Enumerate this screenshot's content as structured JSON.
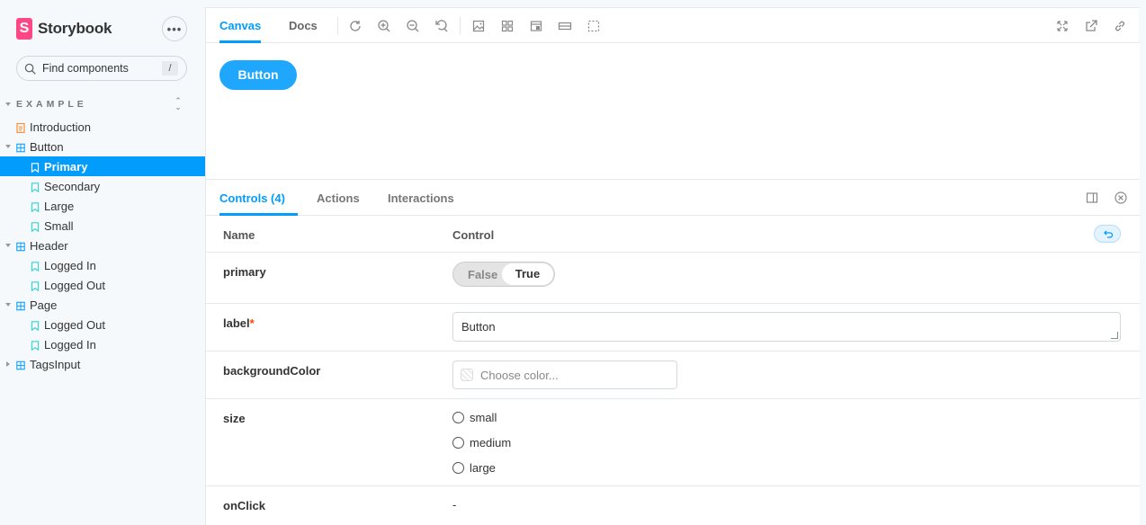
{
  "brand": {
    "logo_letter": "S",
    "name": "Storybook",
    "menu_icon": "ellipsis-icon"
  },
  "search": {
    "placeholder": "Find components",
    "shortcut": "/"
  },
  "sidebar": {
    "section_title": "EXAMPLE",
    "items": [
      {
        "label": "Introduction",
        "type": "docs",
        "level": 0
      },
      {
        "label": "Button",
        "type": "component",
        "level": 0,
        "expanded": true
      },
      {
        "label": "Primary",
        "type": "story",
        "level": 1,
        "selected": true
      },
      {
        "label": "Secondary",
        "type": "story",
        "level": 1
      },
      {
        "label": "Large",
        "type": "story",
        "level": 1
      },
      {
        "label": "Small",
        "type": "story",
        "level": 1
      },
      {
        "label": "Header",
        "type": "component",
        "level": 0,
        "expanded": true
      },
      {
        "label": "Logged In",
        "type": "story",
        "level": 1
      },
      {
        "label": "Logged Out",
        "type": "story",
        "level": 1
      },
      {
        "label": "Page",
        "type": "component",
        "level": 0,
        "expanded": true
      },
      {
        "label": "Logged Out",
        "type": "story",
        "level": 1
      },
      {
        "label": "Logged In",
        "type": "story",
        "level": 1
      },
      {
        "label": "TagsInput",
        "type": "component",
        "level": 0,
        "expanded": false
      }
    ]
  },
  "toolbar": {
    "tabs": [
      {
        "label": "Canvas",
        "active": true
      },
      {
        "label": "Docs",
        "active": false
      }
    ],
    "tools": [
      "reload-icon",
      "zoom-in-icon",
      "zoom-out-icon",
      "zoom-reset-icon",
      "background-icon",
      "grid-icon",
      "viewport-icon",
      "measure-icon",
      "outline-icon"
    ],
    "right_tools": [
      "fullscreen-icon",
      "open-new-tab-icon",
      "copy-link-icon"
    ]
  },
  "canvas": {
    "button_label": "Button"
  },
  "panel": {
    "tabs": [
      {
        "label": "Controls (4)",
        "active": true
      },
      {
        "label": "Actions",
        "active": false
      },
      {
        "label": "Interactions",
        "active": false
      }
    ],
    "columns": {
      "name": "Name",
      "control": "Control"
    },
    "controls": {
      "primary": {
        "name": "primary",
        "false_label": "False",
        "true_label": "True",
        "value": true
      },
      "label": {
        "name": "label",
        "required_mark": "*",
        "value": "Button"
      },
      "backgroundColor": {
        "name": "backgroundColor",
        "placeholder": "Choose color..."
      },
      "size": {
        "name": "size",
        "options": [
          "small",
          "medium",
          "large"
        ]
      },
      "onClick": {
        "name": "onClick",
        "value": "-"
      }
    }
  },
  "colors": {
    "accent": "#029cfd",
    "demo_button": "#1ea7fd",
    "brand": "#ff4785",
    "required": "#ff4400"
  }
}
